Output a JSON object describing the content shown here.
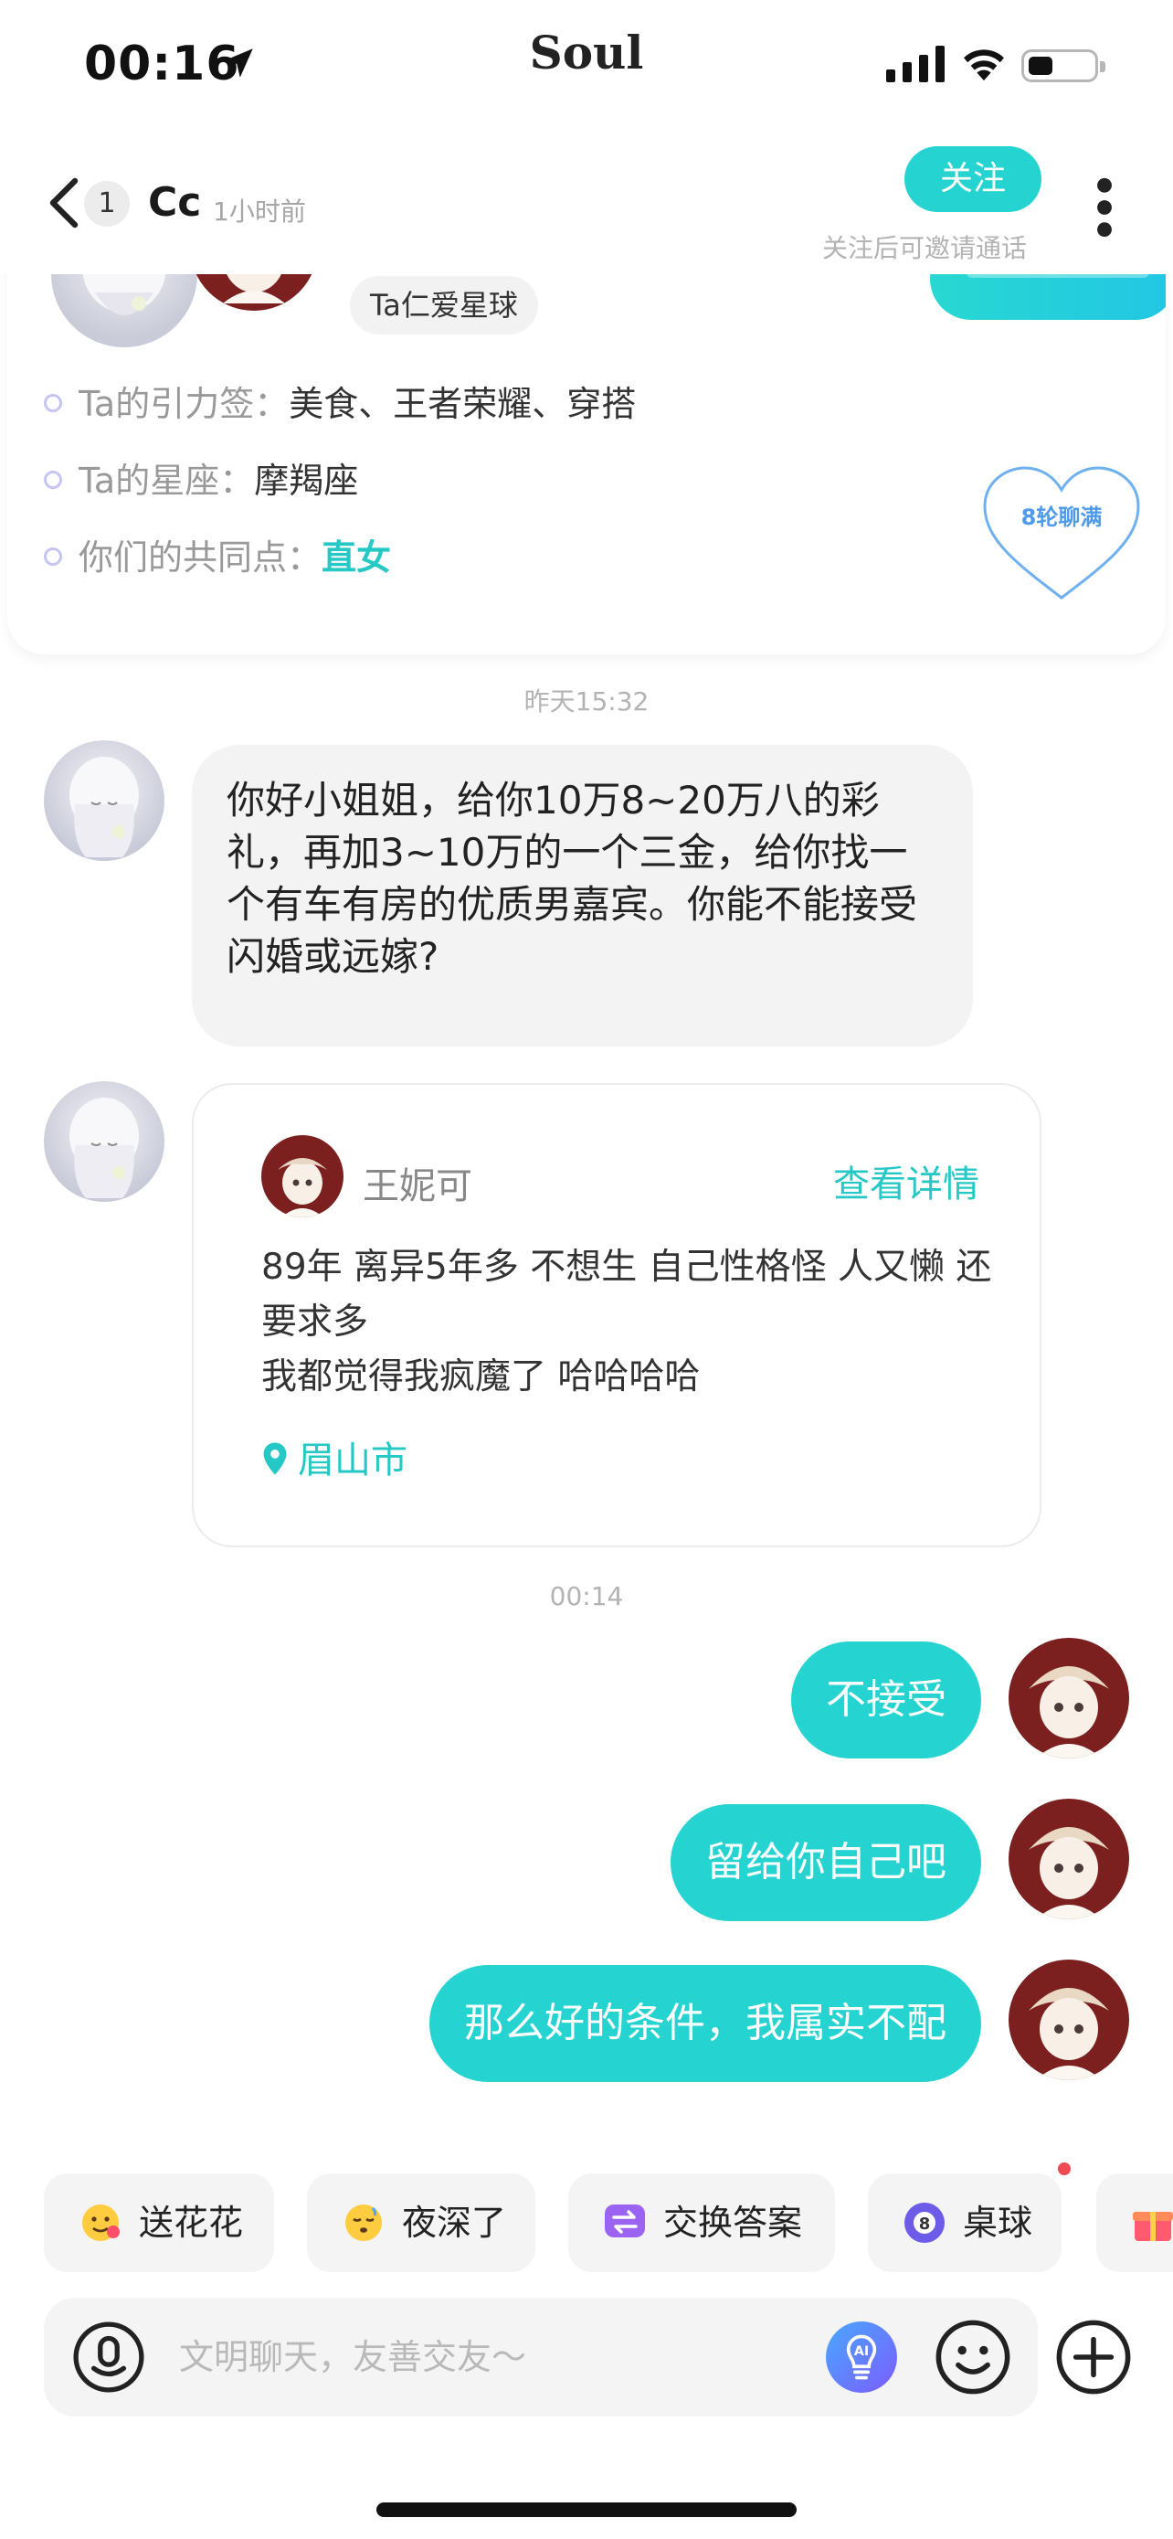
{
  "status_bar": {
    "time": "00:16",
    "app_name": "Soul"
  },
  "header": {
    "unread_count": "1",
    "contact_name": "Cc",
    "last_seen": "1小时前",
    "follow_label": "关注",
    "follow_hint": "关注后可邀请通话"
  },
  "profile_card": {
    "planet_tag": "Ta仁爱星球",
    "tags_label": "Ta的引力签：",
    "tags_value": "美食、王者荣耀、穿搭",
    "zodiac_label": "Ta的星座：",
    "zodiac_value": "摩羯座",
    "common_label": "你们的共同点：",
    "common_value": "直女",
    "heart_badge": "8轮聊满"
  },
  "messages": {
    "timestamp_1": "昨天15:32",
    "incoming_text": "你好小姐姐，给你10万8~20万八的彩礼，再加3~10万的一个三金，给你找一个有车有房的优质男嘉宾。你能不能接受闪婚或远嫁?",
    "share_card": {
      "name": "王妮可",
      "link": "查看详情",
      "text": "89年 离异5年多  不想生  自己性格怪 人又懒  还要求多\n我都觉得我疯魔了  哈哈哈哈",
      "location": "眉山市"
    },
    "timestamp_2": "00:14",
    "outgoing": [
      "不接受",
      "留给你自己吧",
      "那么好的条件，我属实不配"
    ]
  },
  "quick_actions": [
    {
      "label": "送花花",
      "icon": "flower-face-icon"
    },
    {
      "label": "夜深了",
      "icon": "sleepy-face-icon"
    },
    {
      "label": "交换答案",
      "icon": "exchange-icon"
    },
    {
      "label": "桌球",
      "icon": "billiard-ball-icon"
    }
  ],
  "input": {
    "placeholder": "文明聊天，友善交友～",
    "ai_label": "AI"
  },
  "colors": {
    "accent": "#25d4d0",
    "accent_text": "#25c8c4",
    "bubble_in": "#f3f3f3",
    "badge_red": "#f04b55"
  }
}
